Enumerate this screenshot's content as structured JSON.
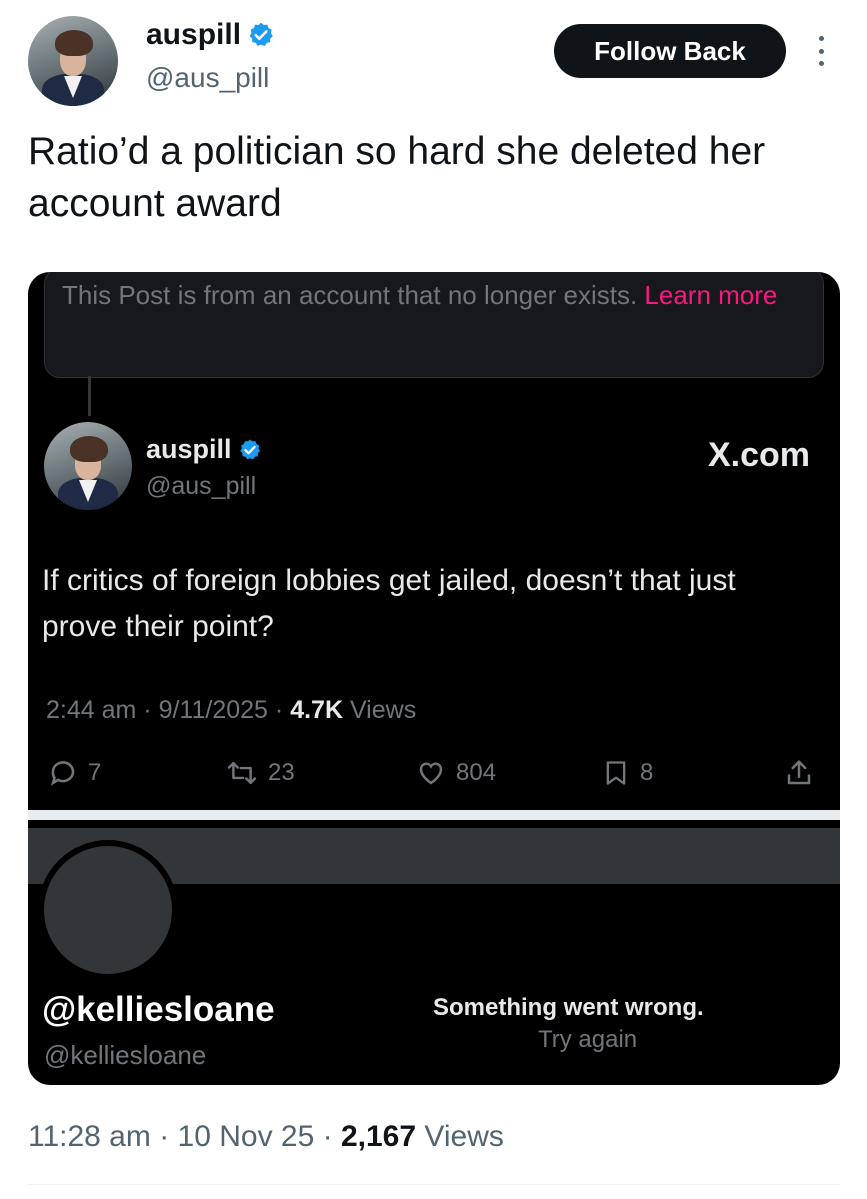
{
  "post": {
    "author_name": "auspill",
    "author_handle": "@aus_pill",
    "follow_label": "Follow Back",
    "text": "Ratio’d a politician so hard she deleted her account award",
    "timestamp": "11:28 am",
    "date": "10 Nov 25",
    "views_count": "2,167",
    "views_label": "Views"
  },
  "embed": {
    "notice_text": "This Post is from an account that no longer exists.",
    "notice_link": "Learn more",
    "author_name": "auspill",
    "author_handle": "@aus_pill",
    "source": "X.com",
    "text": "If critics of foreign lobbies get jailed, doesn’t that just prove their point?",
    "time": "2:44 am",
    "date": "9/11/2025",
    "views_count": "4.7K",
    "views_label": "Views",
    "replies": "7",
    "reposts": "23",
    "likes": "804",
    "bookmarks": "8"
  },
  "profile_card": {
    "display_name": "@kelliesloane",
    "handle": "@kelliesloane",
    "error_text": "Something went wrong.",
    "retry_label": "Try again"
  },
  "icons": {
    "verified": "verified-badge-icon",
    "more": "more-vertical-icon",
    "reply": "reply-icon",
    "repost": "repost-icon",
    "like": "heart-icon",
    "bookmark": "bookmark-icon",
    "share": "share-icon"
  },
  "colors": {
    "verified": "#1d9bf0",
    "link": "#f91880",
    "card_bg": "#000000",
    "button_bg": "#0f1419"
  }
}
